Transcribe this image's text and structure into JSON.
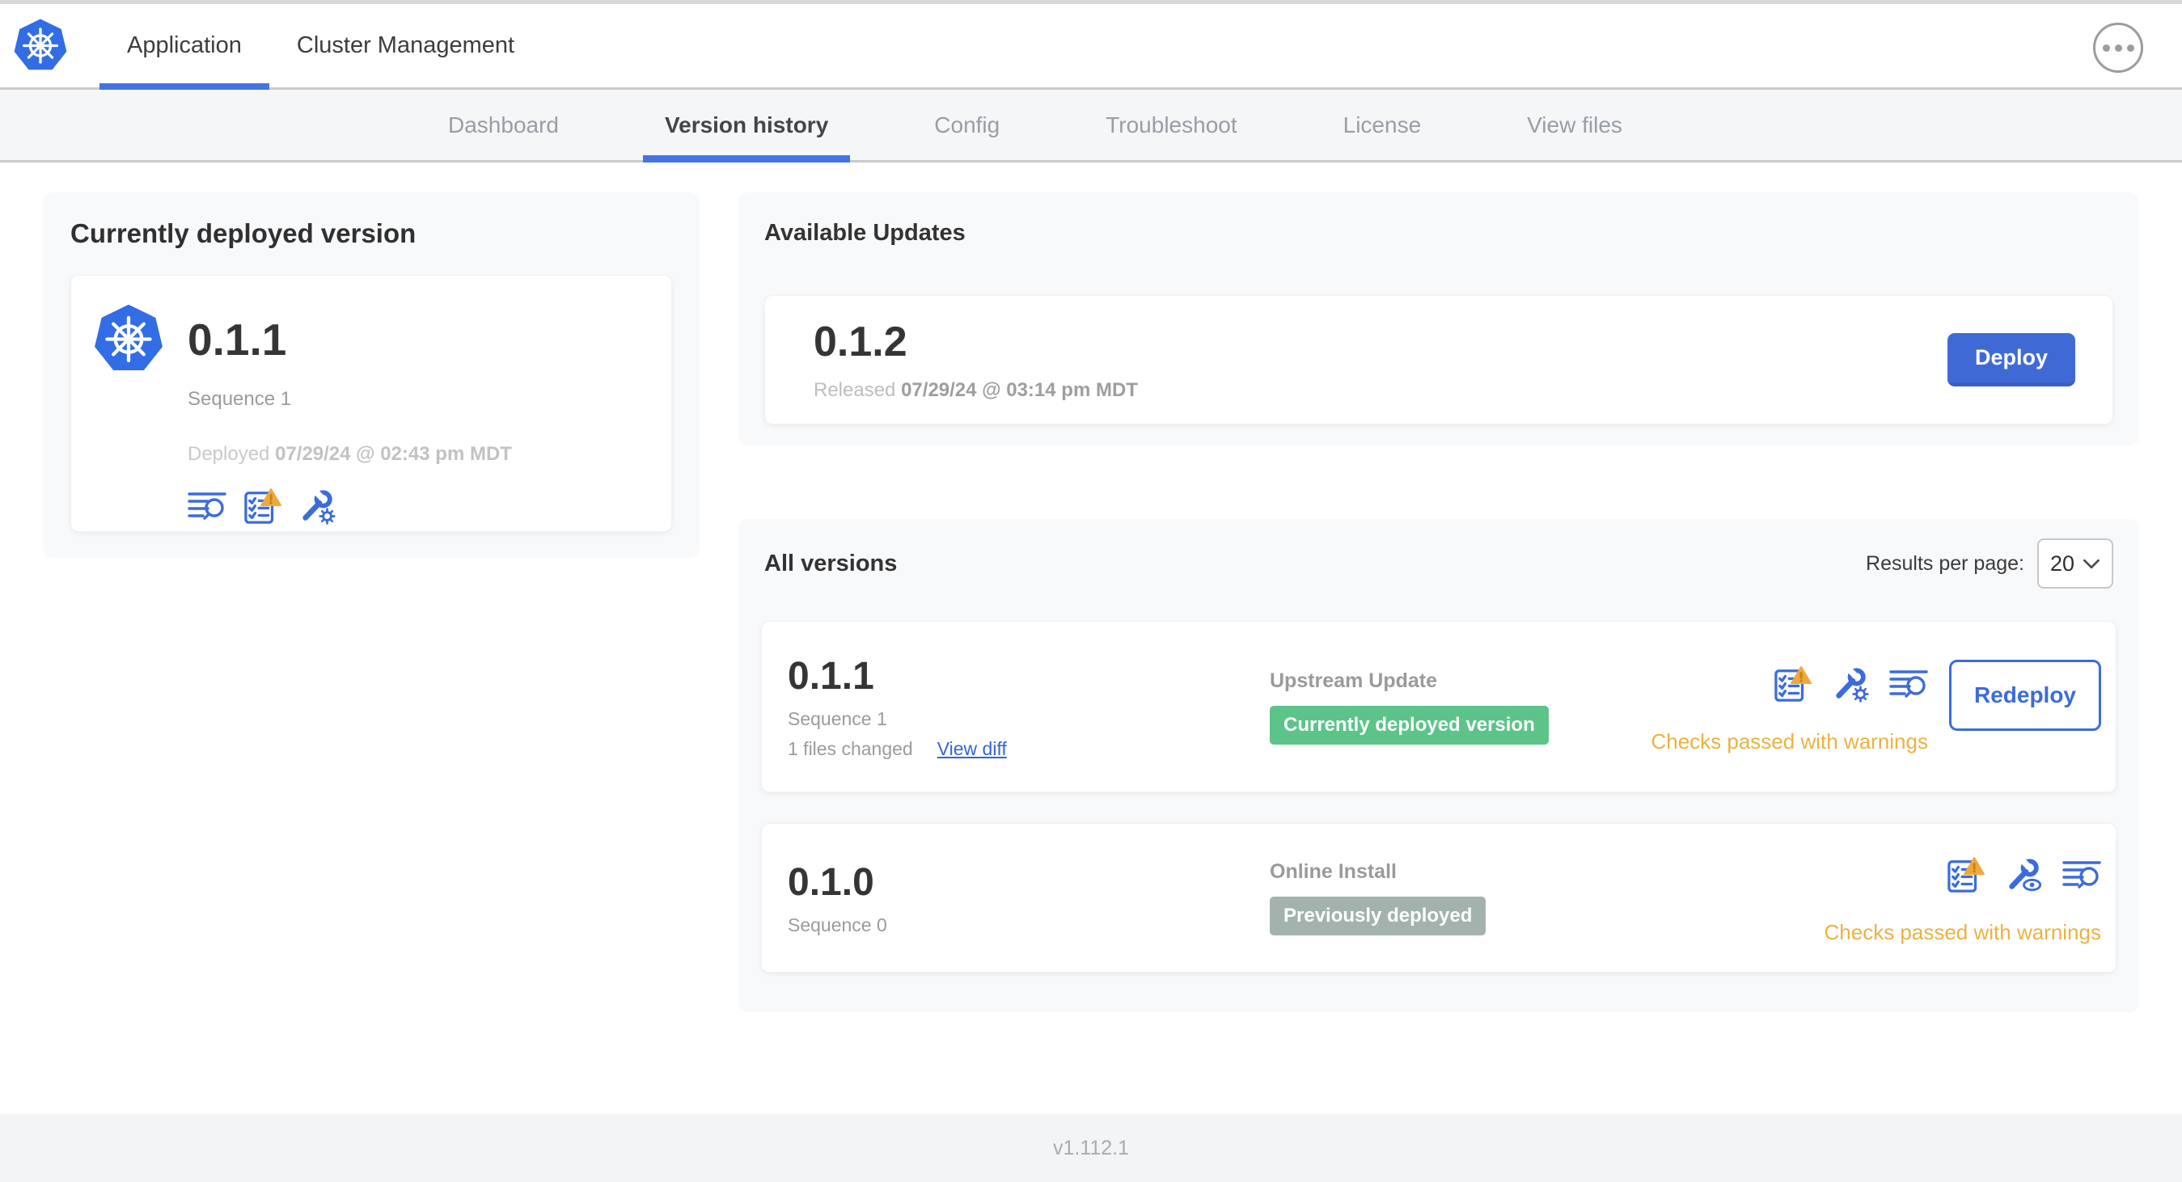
{
  "topbar": {
    "tabs": [
      {
        "label": "Application",
        "active": true
      },
      {
        "label": "Cluster Management",
        "active": false
      }
    ],
    "overflow_icon": "ellipsis-icon"
  },
  "nav": {
    "active": "Version history",
    "tabs": [
      {
        "label": "Dashboard"
      },
      {
        "label": "Version history"
      },
      {
        "label": "Config"
      },
      {
        "label": "Troubleshoot"
      },
      {
        "label": "License"
      },
      {
        "label": "View files"
      }
    ]
  },
  "current_version": {
    "title": "Currently deployed version",
    "version": "0.1.1",
    "sequence": "Sequence 1",
    "deployed_prefix": "Deployed",
    "deployed_date": "07/29/24 @ 02:43 pm MDT",
    "icons": [
      "deploy-logs-icon",
      "preflight-checks-warning-icon",
      "config-edit-icon"
    ]
  },
  "available_updates": {
    "title": "Available Updates",
    "version": "0.1.2",
    "released_prefix": "Released",
    "released_date": "07/29/24 @ 03:14 pm MDT",
    "deploy_label": "Deploy"
  },
  "all_versions": {
    "title": "All versions",
    "results_per_page_label": "Results per page:",
    "results_per_page_value": "20",
    "rows": [
      {
        "version": "0.1.1",
        "sequence": "Sequence 1",
        "files_changed": "1 files changed",
        "view_diff": "View diff",
        "source": "Upstream Update",
        "badge": "Currently deployed version",
        "badge_color": "#5cc489",
        "status": "Checks passed with warnings",
        "action": "Redeploy",
        "icons": [
          "preflight-checks-warning-icon",
          "config-edit-icon",
          "deploy-logs-icon"
        ]
      },
      {
        "version": "0.1.0",
        "sequence": "Sequence 0",
        "source": "Online Install",
        "badge": "Previously deployed",
        "badge_color": "#a3b2ad",
        "status": "Checks passed with warnings",
        "icons": [
          "preflight-checks-warning-icon",
          "config-view-icon",
          "deploy-logs-icon"
        ]
      }
    ]
  },
  "footer": {
    "app_version": "v1.112.1"
  },
  "colors": {
    "accent_blue": "#3b6cdb",
    "kubernetes_blue": "#326de6",
    "badge_green": "#5cc489",
    "badge_gray": "#a3b2ad",
    "warning_orange": "#edb23f"
  }
}
